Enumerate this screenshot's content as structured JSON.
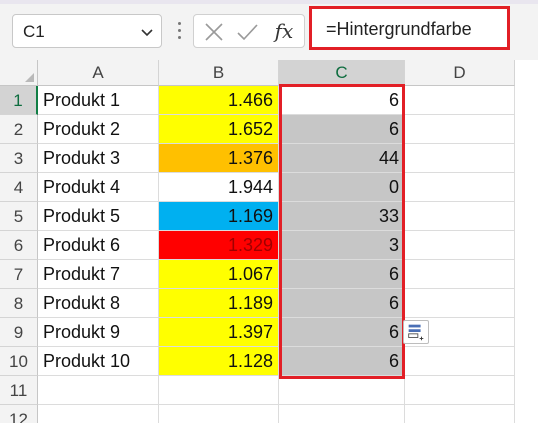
{
  "formula_bar": {
    "name_box": "C1",
    "formula": "=Hintergrundfarbe",
    "fx_label": "fx",
    "icons": [
      "chevron-down-icon",
      "more-options-icon",
      "cancel-x-icon",
      "enter-check-icon",
      "insert-function-icon"
    ]
  },
  "columns": [
    {
      "label": "A",
      "selected": false
    },
    {
      "label": "B",
      "selected": false
    },
    {
      "label": "C",
      "selected": true
    },
    {
      "label": "D",
      "selected": false
    }
  ],
  "rows": [
    {
      "num": "1",
      "a": "Produkt 1",
      "b": "1.466",
      "b_fill": "#ffff00",
      "b_color": "#111111",
      "c": "6"
    },
    {
      "num": "2",
      "a": "Produkt 2",
      "b": "1.652",
      "b_fill": "#ffff00",
      "b_color": "#111111",
      "c": "6"
    },
    {
      "num": "3",
      "a": "Produkt 3",
      "b": "1.376",
      "b_fill": "#ffc000",
      "b_color": "#111111",
      "c": "44"
    },
    {
      "num": "4",
      "a": "Produkt 4",
      "b": "1.944",
      "b_fill": "#ffffff",
      "b_color": "#111111",
      "c": "0"
    },
    {
      "num": "5",
      "a": "Produkt 5",
      "b": "1.169",
      "b_fill": "#00b0f0",
      "b_color": "#111111",
      "c": "33"
    },
    {
      "num": "6",
      "a": "Produkt 6",
      "b": "1.329",
      "b_fill": "#ff0000",
      "b_color": "#a00000",
      "c": "3"
    },
    {
      "num": "7",
      "a": "Produkt 7",
      "b": "1.067",
      "b_fill": "#ffff00",
      "b_color": "#111111",
      "c": "6"
    },
    {
      "num": "8",
      "a": "Produkt 8",
      "b": "1.189",
      "b_fill": "#ffff00",
      "b_color": "#111111",
      "c": "6"
    },
    {
      "num": "9",
      "a": "Produkt 9",
      "b": "1.397",
      "b_fill": "#ffff00",
      "b_color": "#111111",
      "c": "6"
    },
    {
      "num": "10",
      "a": "Produkt 10",
      "b": "1.128",
      "b_fill": "#ffff00",
      "b_color": "#111111",
      "c": "6"
    }
  ],
  "empty_rows": [
    "11",
    "12"
  ],
  "selected_cell": "C1",
  "colors": {
    "highlight_border": "#e21f26",
    "selection_green": "#117e45",
    "selected_range_fill": "#c6c6c6"
  },
  "quick_analysis_icon": "quick-analysis-icon"
}
